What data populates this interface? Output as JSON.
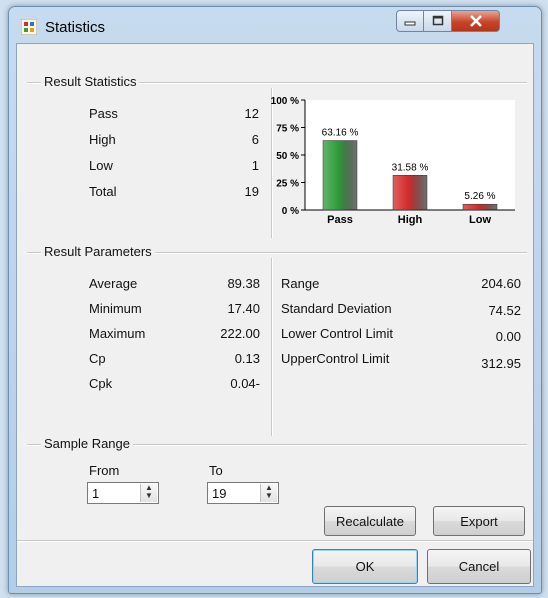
{
  "window": {
    "title": "Statistics",
    "icon": "chart-app-icon"
  },
  "result_statistics": {
    "title": "Result Statistics",
    "rows": [
      {
        "label": "Pass",
        "value": "12"
      },
      {
        "label": "High",
        "value": "6"
      },
      {
        "label": "Low",
        "value": "1"
      },
      {
        "label": "Total",
        "value": "19"
      }
    ]
  },
  "chart_data": {
    "type": "bar",
    "categories": [
      "Pass",
      "High",
      "Low"
    ],
    "values": [
      63.16,
      31.58,
      5.26
    ],
    "value_labels": [
      "63.16 %",
      "31.58 %",
      "5.26 %"
    ],
    "colors": [
      "#2e9a3a",
      "#d32a2a",
      "#d32a2a"
    ],
    "ylim": [
      0,
      100
    ],
    "yticks": [
      "100 %",
      "75 %",
      "50 %",
      "25 %",
      "0 %"
    ],
    "grid": false,
    "title": "",
    "xlabel": "",
    "ylabel": ""
  },
  "result_parameters": {
    "title": "Result Parameters",
    "left": [
      {
        "label": "Average",
        "value": "89.38"
      },
      {
        "label": "Minimum",
        "value": "17.40"
      },
      {
        "label": "Maximum",
        "value": "222.00"
      },
      {
        "label": "Cp",
        "value": "0.13"
      },
      {
        "label": "Cpk",
        "value": "0.04-"
      }
    ],
    "right": [
      {
        "label": "Range",
        "value": "204.60"
      },
      {
        "label": "Standard Deviation",
        "value": "74.52"
      },
      {
        "label": "Lower Control Limit",
        "value": "0.00"
      },
      {
        "label": "UpperControl Limit",
        "value": "312.95"
      }
    ]
  },
  "sample_range": {
    "title": "Sample Range",
    "from_label": "From",
    "from_value": "1",
    "to_label": "To",
    "to_value": "19"
  },
  "buttons": {
    "recalculate": "Recalculate",
    "export": "Export",
    "ok": "OK",
    "cancel": "Cancel"
  }
}
